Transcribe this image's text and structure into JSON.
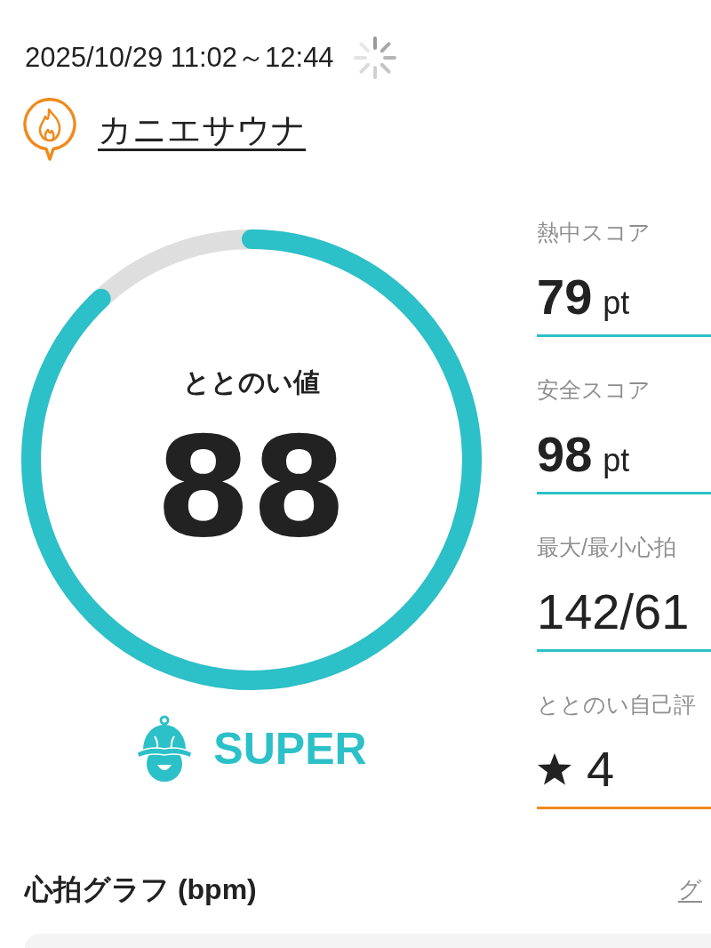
{
  "header": {
    "datetime": "2025/10/29 11:02～12:44"
  },
  "facility": {
    "name": "カニエサウナ"
  },
  "score": {
    "label": "ととのい値",
    "value": "88",
    "level": 0.88,
    "rank": "SUPER"
  },
  "stats": [
    {
      "kind": "score",
      "label": "熱中スコア",
      "value": "79",
      "unit": "pt"
    },
    {
      "kind": "score",
      "label": "安全スコア",
      "value": "98",
      "unit": "pt"
    },
    {
      "kind": "number",
      "label": "最大/最小心拍",
      "value": "142/61"
    },
    {
      "kind": "rating",
      "label": "ととのい自己評",
      "value": "4"
    }
  ],
  "heart_graph": {
    "title": "心拍グラフ (bpm)",
    "link": "グ"
  }
}
